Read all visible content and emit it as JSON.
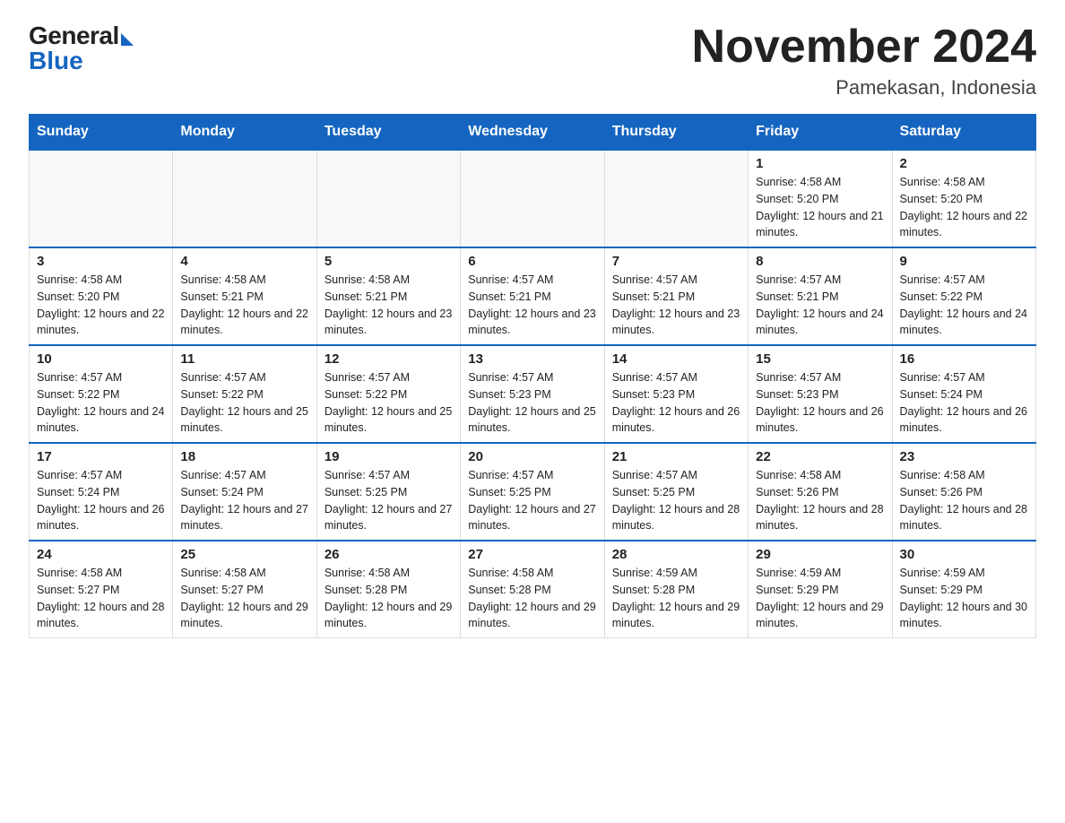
{
  "logo": {
    "general": "General",
    "blue": "Blue"
  },
  "title": {
    "month_year": "November 2024",
    "location": "Pamekasan, Indonesia"
  },
  "days_of_week": [
    "Sunday",
    "Monday",
    "Tuesday",
    "Wednesday",
    "Thursday",
    "Friday",
    "Saturday"
  ],
  "weeks": [
    {
      "days": [
        {
          "date": "",
          "empty": true
        },
        {
          "date": "",
          "empty": true
        },
        {
          "date": "",
          "empty": true
        },
        {
          "date": "",
          "empty": true
        },
        {
          "date": "",
          "empty": true
        },
        {
          "date": "1",
          "sunrise": "Sunrise: 4:58 AM",
          "sunset": "Sunset: 5:20 PM",
          "daylight": "Daylight: 12 hours and 21 minutes."
        },
        {
          "date": "2",
          "sunrise": "Sunrise: 4:58 AM",
          "sunset": "Sunset: 5:20 PM",
          "daylight": "Daylight: 12 hours and 22 minutes."
        }
      ]
    },
    {
      "days": [
        {
          "date": "3",
          "sunrise": "Sunrise: 4:58 AM",
          "sunset": "Sunset: 5:20 PM",
          "daylight": "Daylight: 12 hours and 22 minutes."
        },
        {
          "date": "4",
          "sunrise": "Sunrise: 4:58 AM",
          "sunset": "Sunset: 5:21 PM",
          "daylight": "Daylight: 12 hours and 22 minutes."
        },
        {
          "date": "5",
          "sunrise": "Sunrise: 4:58 AM",
          "sunset": "Sunset: 5:21 PM",
          "daylight": "Daylight: 12 hours and 23 minutes."
        },
        {
          "date": "6",
          "sunrise": "Sunrise: 4:57 AM",
          "sunset": "Sunset: 5:21 PM",
          "daylight": "Daylight: 12 hours and 23 minutes."
        },
        {
          "date": "7",
          "sunrise": "Sunrise: 4:57 AM",
          "sunset": "Sunset: 5:21 PM",
          "daylight": "Daylight: 12 hours and 23 minutes."
        },
        {
          "date": "8",
          "sunrise": "Sunrise: 4:57 AM",
          "sunset": "Sunset: 5:21 PM",
          "daylight": "Daylight: 12 hours and 24 minutes."
        },
        {
          "date": "9",
          "sunrise": "Sunrise: 4:57 AM",
          "sunset": "Sunset: 5:22 PM",
          "daylight": "Daylight: 12 hours and 24 minutes."
        }
      ]
    },
    {
      "days": [
        {
          "date": "10",
          "sunrise": "Sunrise: 4:57 AM",
          "sunset": "Sunset: 5:22 PM",
          "daylight": "Daylight: 12 hours and 24 minutes."
        },
        {
          "date": "11",
          "sunrise": "Sunrise: 4:57 AM",
          "sunset": "Sunset: 5:22 PM",
          "daylight": "Daylight: 12 hours and 25 minutes."
        },
        {
          "date": "12",
          "sunrise": "Sunrise: 4:57 AM",
          "sunset": "Sunset: 5:22 PM",
          "daylight": "Daylight: 12 hours and 25 minutes."
        },
        {
          "date": "13",
          "sunrise": "Sunrise: 4:57 AM",
          "sunset": "Sunset: 5:23 PM",
          "daylight": "Daylight: 12 hours and 25 minutes."
        },
        {
          "date": "14",
          "sunrise": "Sunrise: 4:57 AM",
          "sunset": "Sunset: 5:23 PM",
          "daylight": "Daylight: 12 hours and 26 minutes."
        },
        {
          "date": "15",
          "sunrise": "Sunrise: 4:57 AM",
          "sunset": "Sunset: 5:23 PM",
          "daylight": "Daylight: 12 hours and 26 minutes."
        },
        {
          "date": "16",
          "sunrise": "Sunrise: 4:57 AM",
          "sunset": "Sunset: 5:24 PM",
          "daylight": "Daylight: 12 hours and 26 minutes."
        }
      ]
    },
    {
      "days": [
        {
          "date": "17",
          "sunrise": "Sunrise: 4:57 AM",
          "sunset": "Sunset: 5:24 PM",
          "daylight": "Daylight: 12 hours and 26 minutes."
        },
        {
          "date": "18",
          "sunrise": "Sunrise: 4:57 AM",
          "sunset": "Sunset: 5:24 PM",
          "daylight": "Daylight: 12 hours and 27 minutes."
        },
        {
          "date": "19",
          "sunrise": "Sunrise: 4:57 AM",
          "sunset": "Sunset: 5:25 PM",
          "daylight": "Daylight: 12 hours and 27 minutes."
        },
        {
          "date": "20",
          "sunrise": "Sunrise: 4:57 AM",
          "sunset": "Sunset: 5:25 PM",
          "daylight": "Daylight: 12 hours and 27 minutes."
        },
        {
          "date": "21",
          "sunrise": "Sunrise: 4:57 AM",
          "sunset": "Sunset: 5:25 PM",
          "daylight": "Daylight: 12 hours and 28 minutes."
        },
        {
          "date": "22",
          "sunrise": "Sunrise: 4:58 AM",
          "sunset": "Sunset: 5:26 PM",
          "daylight": "Daylight: 12 hours and 28 minutes."
        },
        {
          "date": "23",
          "sunrise": "Sunrise: 4:58 AM",
          "sunset": "Sunset: 5:26 PM",
          "daylight": "Daylight: 12 hours and 28 minutes."
        }
      ]
    },
    {
      "days": [
        {
          "date": "24",
          "sunrise": "Sunrise: 4:58 AM",
          "sunset": "Sunset: 5:27 PM",
          "daylight": "Daylight: 12 hours and 28 minutes."
        },
        {
          "date": "25",
          "sunrise": "Sunrise: 4:58 AM",
          "sunset": "Sunset: 5:27 PM",
          "daylight": "Daylight: 12 hours and 29 minutes."
        },
        {
          "date": "26",
          "sunrise": "Sunrise: 4:58 AM",
          "sunset": "Sunset: 5:28 PM",
          "daylight": "Daylight: 12 hours and 29 minutes."
        },
        {
          "date": "27",
          "sunrise": "Sunrise: 4:58 AM",
          "sunset": "Sunset: 5:28 PM",
          "daylight": "Daylight: 12 hours and 29 minutes."
        },
        {
          "date": "28",
          "sunrise": "Sunrise: 4:59 AM",
          "sunset": "Sunset: 5:28 PM",
          "daylight": "Daylight: 12 hours and 29 minutes."
        },
        {
          "date": "29",
          "sunrise": "Sunrise: 4:59 AM",
          "sunset": "Sunset: 5:29 PM",
          "daylight": "Daylight: 12 hours and 29 minutes."
        },
        {
          "date": "30",
          "sunrise": "Sunrise: 4:59 AM",
          "sunset": "Sunset: 5:29 PM",
          "daylight": "Daylight: 12 hours and 30 minutes."
        }
      ]
    }
  ],
  "colors": {
    "header_bg": "#1565c0",
    "header_text": "#ffffff",
    "border_accent": "#1565c0"
  }
}
